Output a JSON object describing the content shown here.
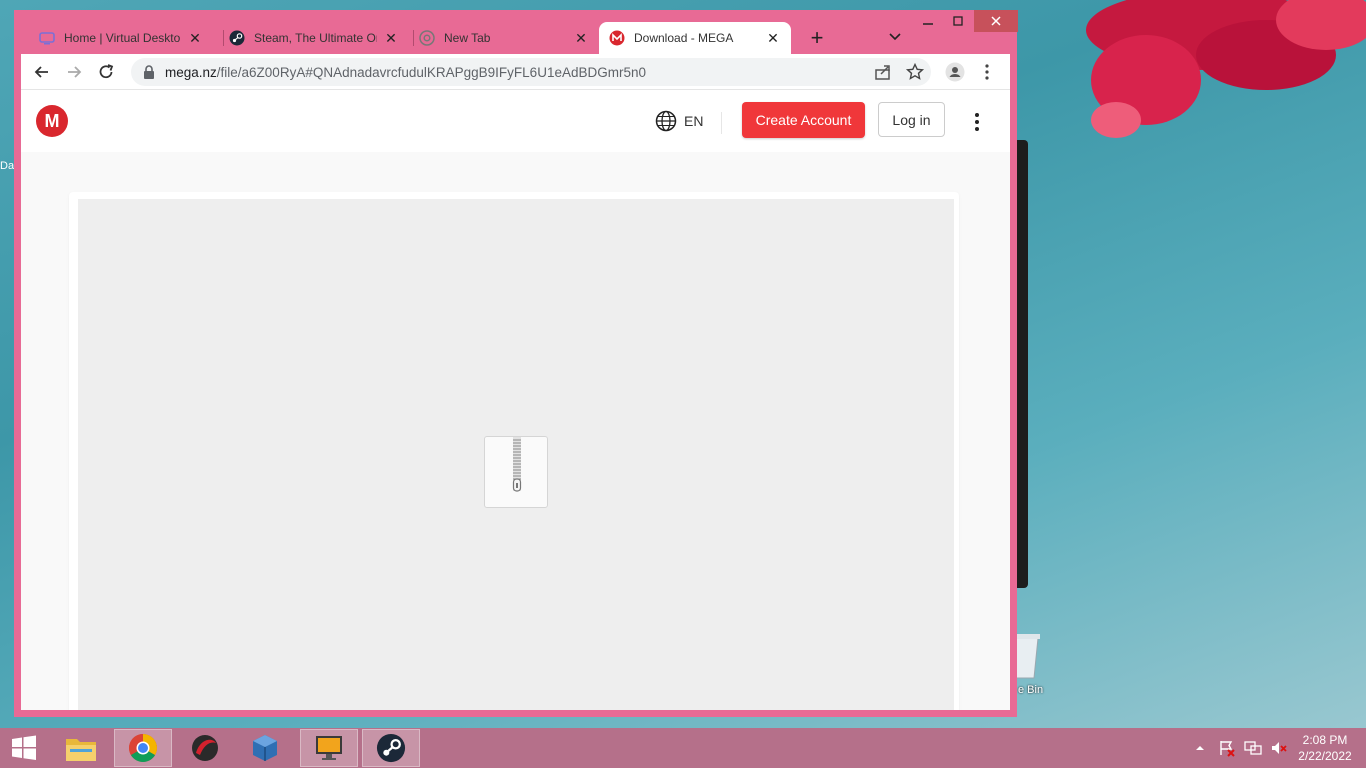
{
  "desktop": {
    "edge_text": "Da",
    "recycle_bin_label": "e Bin"
  },
  "browser": {
    "tabs": [
      {
        "title": "Home | Virtual Desktop",
        "favicon": "virtual-desktop-icon",
        "active": false
      },
      {
        "title": "Steam, The Ultimate Online Game Platform",
        "favicon": "steam-icon",
        "active": false
      },
      {
        "title": "New Tab",
        "favicon": "chrome-icon",
        "active": false
      },
      {
        "title": "Download - MEGA",
        "favicon": "mega-icon",
        "active": true
      }
    ],
    "new_tab_label": "+",
    "url": {
      "host": "mega.nz",
      "path": "/file/a6Z00RyA#QNAdnadavrcfudulKRAPggB9IFyFL6U1eAdBDGmr5n0"
    }
  },
  "mega": {
    "logo_letter": "M",
    "language": "EN",
    "create_account_label": "Create Account",
    "login_label": "Log in",
    "brand_color": "#d9272e",
    "button_color": "#f0373a"
  },
  "taskbar": {
    "apps": [
      "windows-start-icon",
      "file-explorer-icon",
      "chrome-icon",
      "redapp-icon",
      "virtualbox-icon",
      "monitor-app-icon",
      "steam-icon"
    ],
    "clock_time": "2:08 PM",
    "clock_date": "2/22/2022"
  }
}
